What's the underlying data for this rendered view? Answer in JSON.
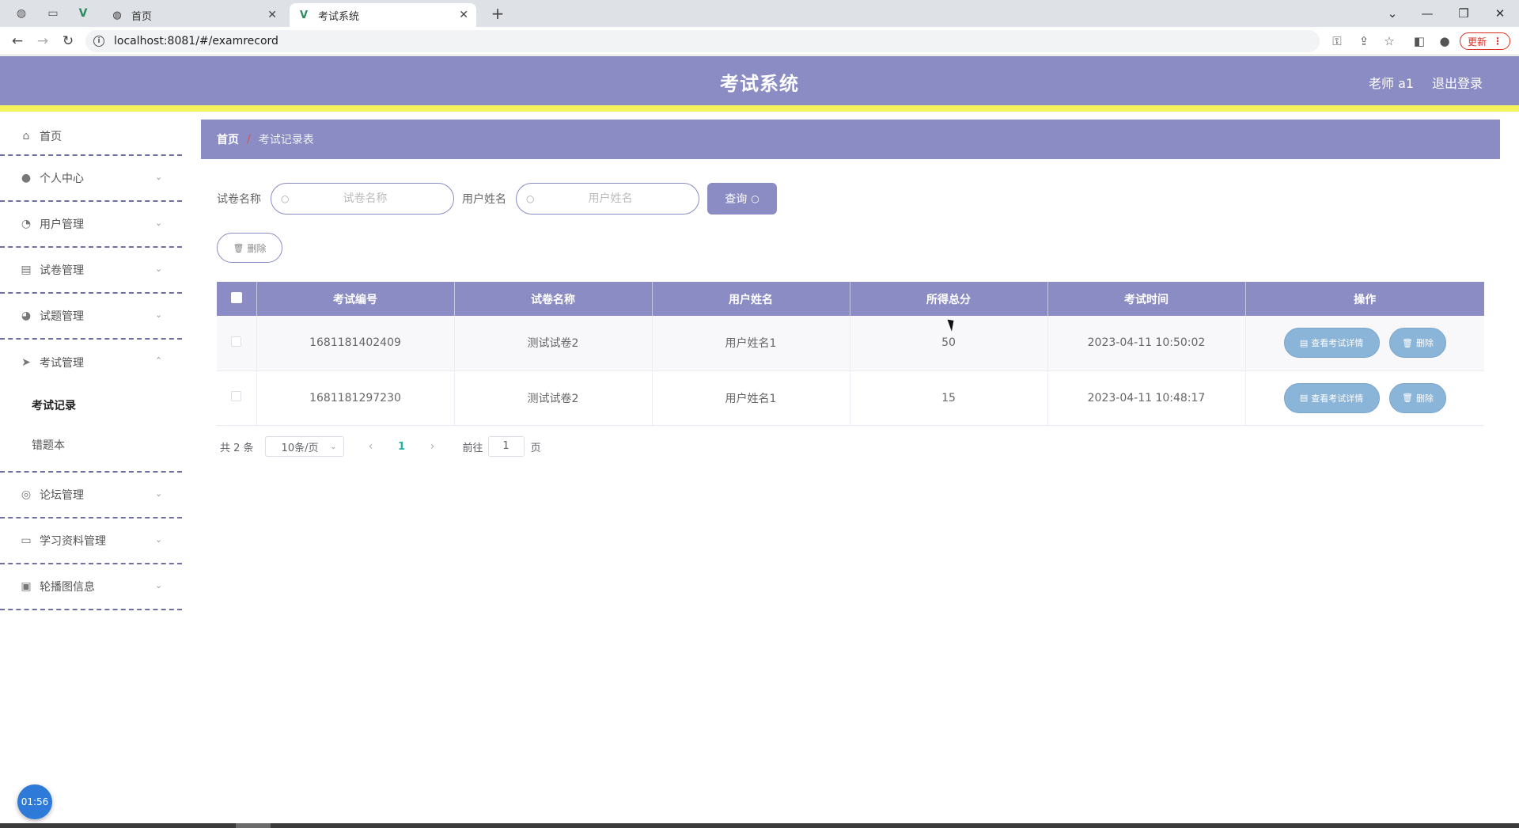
{
  "browser": {
    "tabs": [
      {
        "label": "首页",
        "icon": "globe-icon",
        "active": false
      },
      {
        "label": "考试系统",
        "icon": "vue-logo-icon",
        "active": true
      }
    ],
    "url": "localhost:8081/#/examrecord",
    "update_label": "更新"
  },
  "header": {
    "title": "考试系统",
    "user": "老师 a1",
    "logout": "退出登录"
  },
  "sidebar": {
    "items": [
      {
        "label": "首页",
        "icon": "home-icon",
        "expandable": false
      },
      {
        "label": "个人中心",
        "icon": "user-icon",
        "expandable": true
      },
      {
        "label": "用户管理",
        "icon": "dashboard-icon",
        "expandable": true
      },
      {
        "label": "试卷管理",
        "icon": "tickets-icon",
        "expandable": true
      },
      {
        "label": "试题管理",
        "icon": "ice-cream-icon",
        "expandable": true
      },
      {
        "label": "考试管理",
        "icon": "send-icon",
        "expandable": true,
        "open": true,
        "children": [
          {
            "label": "考试记录",
            "active": true
          },
          {
            "label": "错题本",
            "active": false
          }
        ]
      },
      {
        "label": "论坛管理",
        "icon": "basketball-icon",
        "expandable": true
      },
      {
        "label": "学习资料管理",
        "icon": "chat-icon",
        "expandable": true
      },
      {
        "label": "轮播图信息",
        "icon": "suitcase-icon",
        "expandable": true
      }
    ],
    "timer": "01:56"
  },
  "breadcrumb": {
    "home": "首页",
    "separator": "/",
    "current": "考试记录表"
  },
  "search": {
    "paper_label": "试卷名称",
    "paper_placeholder": "试卷名称",
    "user_label": "用户姓名",
    "user_placeholder": "用户姓名",
    "query_label": "查询"
  },
  "actions": {
    "delete_label": "删除"
  },
  "table": {
    "columns": [
      "考试编号",
      "试卷名称",
      "用户姓名",
      "所得总分",
      "考试时间",
      "操作"
    ],
    "rows": [
      {
        "id": "1681181402409",
        "paper": "测试试卷2",
        "user": "用户姓名1",
        "score": "50",
        "time": "2023-04-11 10:50:02"
      },
      {
        "id": "1681181297230",
        "paper": "测试试卷2",
        "user": "用户姓名1",
        "score": "15",
        "time": "2023-04-11 10:48:17"
      }
    ],
    "detail_label": "查看考试详情",
    "row_delete_label": "删除"
  },
  "pagination": {
    "total": "共 2 条",
    "page_size": "10条/页",
    "current_page": "1",
    "jump_prefix": "前往",
    "jump_value": "1",
    "jump_suffix": "页"
  },
  "colors": {
    "primary": "#8a8cc3",
    "header_accent": "#f4f25d",
    "op_button": "#8ab4d8",
    "page_active": "#27b0a0"
  }
}
